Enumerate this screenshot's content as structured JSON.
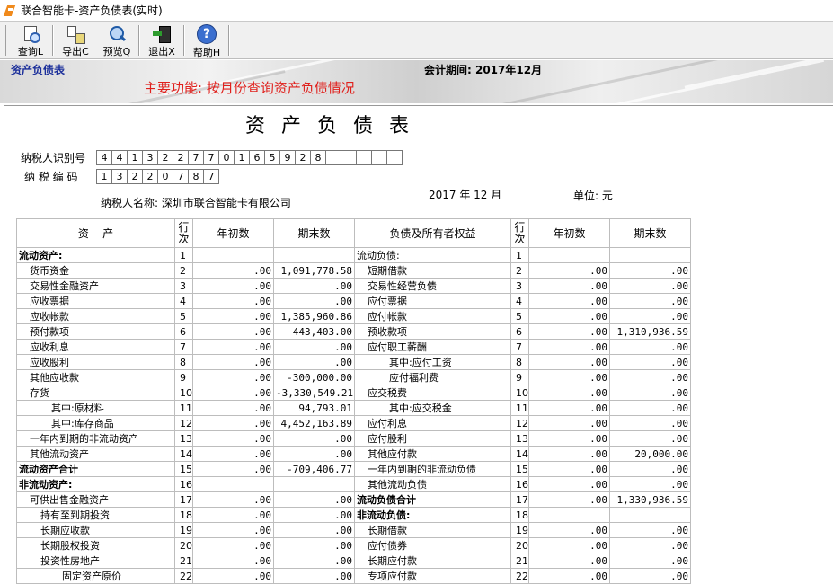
{
  "window": {
    "title": "联合智能卡-资产负债表(实时)"
  },
  "toolbar": {
    "buttons": [
      {
        "label": "查询L",
        "icon": "query-icon"
      },
      {
        "label": "导出C",
        "icon": "export-icon"
      },
      {
        "label": "预览Q",
        "icon": "preview-icon"
      },
      {
        "label": "退出X",
        "icon": "exit-icon"
      },
      {
        "label": "帮助H",
        "icon": "help-icon"
      }
    ]
  },
  "banner": {
    "module": "资产负债表",
    "period": "会计期间: 2017年12月",
    "function_note": "主要功能: 按月份查询资产负债情况"
  },
  "report": {
    "title": "资产负债表",
    "taxpayer_id_label": "纳税人识别号",
    "taxpayer_id_digits": [
      "4",
      "4",
      "1",
      "3",
      "2",
      "2",
      "7",
      "7",
      "0",
      "1",
      "6",
      "5",
      "9",
      "2",
      "8",
      "",
      "",
      "",
      "",
      ""
    ],
    "tax_code_label": "纳 税 编 码",
    "tax_code_digits": [
      "1",
      "3",
      "2",
      "2",
      "0",
      "7",
      "8",
      "7"
    ],
    "taxpayer_name": "纳税人名称: 深圳市联合智能卡有限公司",
    "report_date": "2017 年 12 月",
    "unit": "单位: 元",
    "headers": {
      "assets": "资    产",
      "line": "行次",
      "begin": "年初数",
      "end": "期末数",
      "liabilities": "负债及所有者权益",
      "line2": "行次",
      "begin2": "年初数",
      "end2": "期末数"
    },
    "rows": [
      {
        "a_name": "流动资产:",
        "a_bold": true,
        "a_indent": 0,
        "a_line": "1",
        "a_begin": "",
        "a_end": "",
        "l_name": "流动负债:",
        "l_bold": false,
        "l_indent": 0,
        "l_line": "1",
        "l_begin": "",
        "l_end": ""
      },
      {
        "a_name": "货币资金",
        "a_indent": 1,
        "a_line": "2",
        "a_begin": ".00",
        "a_end": "1,091,778.58",
        "l_name": "短期借款",
        "l_indent": 1,
        "l_line": "2",
        "l_begin": ".00",
        "l_end": ".00"
      },
      {
        "a_name": "交易性金融资产",
        "a_indent": 1,
        "a_line": "3",
        "a_begin": ".00",
        "a_end": ".00",
        "l_name": "交易性经营负债",
        "l_indent": 1,
        "l_line": "3",
        "l_begin": ".00",
        "l_end": ".00"
      },
      {
        "a_name": "应收票据",
        "a_indent": 1,
        "a_line": "4",
        "a_begin": ".00",
        "a_end": ".00",
        "l_name": "应付票据",
        "l_indent": 1,
        "l_line": "4",
        "l_begin": ".00",
        "l_end": ".00"
      },
      {
        "a_name": "应收帐款",
        "a_indent": 1,
        "a_line": "5",
        "a_begin": ".00",
        "a_end": "1,385,960.86",
        "l_name": "应付帐款",
        "l_indent": 1,
        "l_line": "5",
        "l_begin": ".00",
        "l_end": ".00"
      },
      {
        "a_name": "预付款项",
        "a_indent": 1,
        "a_line": "6",
        "a_begin": ".00",
        "a_end": "443,403.00",
        "l_name": "预收款项",
        "l_indent": 1,
        "l_line": "6",
        "l_begin": ".00",
        "l_end": "1,310,936.59"
      },
      {
        "a_name": "应收利息",
        "a_indent": 1,
        "a_line": "7",
        "a_begin": ".00",
        "a_end": ".00",
        "l_name": "应付职工薪酬",
        "l_indent": 1,
        "l_line": "7",
        "l_begin": ".00",
        "l_end": ".00"
      },
      {
        "a_name": "应收股利",
        "a_indent": 1,
        "a_line": "8",
        "a_begin": ".00",
        "a_end": ".00",
        "l_name": "其中:应付工资",
        "l_indent": 3,
        "l_line": "8",
        "l_begin": ".00",
        "l_end": ".00"
      },
      {
        "a_name": "其他应收款",
        "a_indent": 1,
        "a_line": "9",
        "a_begin": ".00",
        "a_end": "-300,000.00",
        "l_name": "应付福利费",
        "l_indent": 3,
        "l_line": "9",
        "l_begin": ".00",
        "l_end": ".00"
      },
      {
        "a_name": "存货",
        "a_indent": 1,
        "a_line": "10",
        "a_begin": ".00",
        "a_end": "-3,330,549.21",
        "l_name": "应交税费",
        "l_indent": 1,
        "l_line": "10",
        "l_begin": ".00",
        "l_end": ".00"
      },
      {
        "a_name": "其中:原材料",
        "a_indent": 3,
        "a_line": "11",
        "a_begin": ".00",
        "a_end": "94,793.01",
        "l_name": "其中:应交税金",
        "l_indent": 3,
        "l_line": "11",
        "l_begin": ".00",
        "l_end": ".00"
      },
      {
        "a_name": "其中:库存商品",
        "a_indent": 3,
        "a_line": "12",
        "a_begin": ".00",
        "a_end": "4,452,163.89",
        "l_name": "应付利息",
        "l_indent": 1,
        "l_line": "12",
        "l_begin": ".00",
        "l_end": ".00"
      },
      {
        "a_name": "一年内到期的非流动资产",
        "a_indent": 1,
        "a_line": "13",
        "a_begin": ".00",
        "a_end": ".00",
        "l_name": "应付股利",
        "l_indent": 1,
        "l_line": "13",
        "l_begin": ".00",
        "l_end": ".00"
      },
      {
        "a_name": "其他流动资产",
        "a_indent": 1,
        "a_line": "14",
        "a_begin": ".00",
        "a_end": ".00",
        "l_name": "其他应付款",
        "l_indent": 1,
        "l_line": "14",
        "l_begin": ".00",
        "l_end": "20,000.00"
      },
      {
        "a_name": "流动资产合计",
        "a_bold": true,
        "a_indent": 0,
        "a_line": "15",
        "a_begin": ".00",
        "a_end": "-709,406.77",
        "l_name": "一年内到期的非流动负债",
        "l_indent": 1,
        "l_line": "15",
        "l_begin": ".00",
        "l_end": ".00"
      },
      {
        "a_name": "非流动资产:",
        "a_bold": true,
        "a_indent": 0,
        "a_line": "16",
        "a_begin": "",
        "a_end": "",
        "l_name": "其他流动负债",
        "l_indent": 1,
        "l_line": "16",
        "l_begin": ".00",
        "l_end": ".00"
      },
      {
        "a_name": "可供出售金融资产",
        "a_indent": 1,
        "a_line": "17",
        "a_begin": ".00",
        "a_end": ".00",
        "l_name": "流动负债合计",
        "l_bold": true,
        "l_indent": 0,
        "l_line": "17",
        "l_begin": ".00",
        "l_end": "1,330,936.59"
      },
      {
        "a_name": "持有至到期投资",
        "a_indent": 2,
        "a_line": "18",
        "a_begin": ".00",
        "a_end": ".00",
        "l_name": "非流动负债:",
        "l_bold": true,
        "l_indent": 0,
        "l_line": "18",
        "l_begin": "",
        "l_end": ""
      },
      {
        "a_name": "长期应收款",
        "a_indent": 2,
        "a_line": "19",
        "a_begin": ".00",
        "a_end": ".00",
        "l_name": "长期借款",
        "l_indent": 1,
        "l_line": "19",
        "l_begin": ".00",
        "l_end": ".00"
      },
      {
        "a_name": "长期股权投资",
        "a_indent": 2,
        "a_line": "20",
        "a_begin": ".00",
        "a_end": ".00",
        "l_name": "应付债券",
        "l_indent": 1,
        "l_line": "20",
        "l_begin": ".00",
        "l_end": ".00"
      },
      {
        "a_name": "投资性房地产",
        "a_indent": 2,
        "a_line": "21",
        "a_begin": ".00",
        "a_end": ".00",
        "l_name": "长期应付款",
        "l_indent": 1,
        "l_line": "21",
        "l_begin": ".00",
        "l_end": ".00"
      },
      {
        "a_name": "固定资产原价",
        "a_indent": 4,
        "a_line": "22",
        "a_begin": ".00",
        "a_end": ".00",
        "l_name": "专项应付款",
        "l_indent": 1,
        "l_line": "22",
        "l_begin": ".00",
        "l_end": ".00"
      }
    ]
  }
}
